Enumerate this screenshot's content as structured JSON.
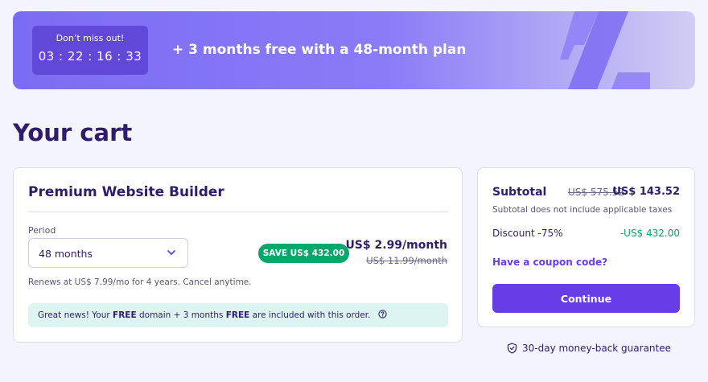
{
  "banner": {
    "timer_label": "Don’t miss out!",
    "timer_value": "03 : 22 : 16 : 33",
    "promo_text": "+ 3 months free with a 48-month plan"
  },
  "page_title": "Your cart",
  "product": {
    "title": "Premium Website Builder",
    "period_label": "Period",
    "period_value": "48 months",
    "save_badge": "SAVE US$ 432.00",
    "price_now": "US$ 2.99/month",
    "price_old": "US$ 11.99/month",
    "renew_text": "Renews at US$ 7.99/mo for 4 years. Cancel anytime.",
    "notice": {
      "part1": "Great news! Your ",
      "free1": "FREE",
      "part2": " domain + 3 months ",
      "free2": "FREE",
      "part3": " are included with this order."
    }
  },
  "summary": {
    "subtotal_label": "Subtotal",
    "subtotal_old": "US$ 575.52",
    "subtotal_total": "US$ 143.52",
    "subtotal_note": "Subtotal does not include applicable taxes",
    "discount_label": "Discount -75%",
    "discount_value": "-US$ 432.00",
    "coupon_link": "Have a coupon code?",
    "continue_label": "Continue"
  },
  "guarantee": "30-day money-back guarantee",
  "colors": {
    "primary": "#673de6",
    "success": "#00a86b",
    "heading": "#2f1c6a",
    "notice_bg": "#def4f0"
  },
  "icons": {
    "period_select": "chevron-down-icon",
    "notice": "question-circle-icon",
    "guarantee": "shield-check-icon",
    "banner_art": "percent-icon"
  }
}
